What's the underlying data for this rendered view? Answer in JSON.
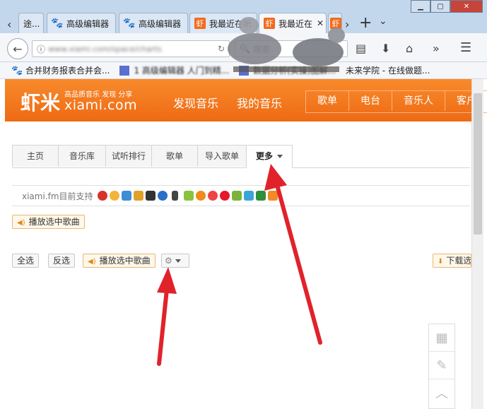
{
  "browser": {
    "tabs": [
      {
        "label": "途..."
      },
      {
        "label": "高级编辑器"
      },
      {
        "label": "高级编辑器"
      },
      {
        "label": "我最近在听"
      },
      {
        "label": "我最近在"
      }
    ],
    "new_tab": "+",
    "tab_list": "⌄",
    "back_icon": "arrow-left-icon",
    "url": "www.xiami.com/space/charts",
    "search_placeholder": "搜索",
    "bookmarks": [
      {
        "label": "合并财务报表合并会..."
      },
      {
        "label": "1 高级编辑器 人门到精..."
      },
      {
        "label": "数据分析(实操)图解..."
      },
      {
        "label": "未来学院 - 在线做题..."
      }
    ]
  },
  "xiami": {
    "logo_text": "虾米",
    "logo_slogan": "高品质音乐 发现 分享",
    "logo_domain": "xiami.com",
    "main_nav": [
      "发现音乐",
      "我的音乐"
    ],
    "sub_nav": [
      "歌单",
      "电台",
      "音乐人",
      "客户端"
    ],
    "tabs": [
      "主页",
      "音乐库",
      "试听排行",
      "歌单",
      "导入歌单",
      "更多"
    ],
    "support_text": "xiami.fm目前支持",
    "play_selected": "播放选中歌曲",
    "select_all": "全选",
    "invert_select": "反选",
    "play_selected_2": "播放选中歌曲",
    "download_selected": "下载选"
  },
  "colors": {
    "brand_orange": "#f27a20",
    "arrow_red": "#e0232b"
  }
}
